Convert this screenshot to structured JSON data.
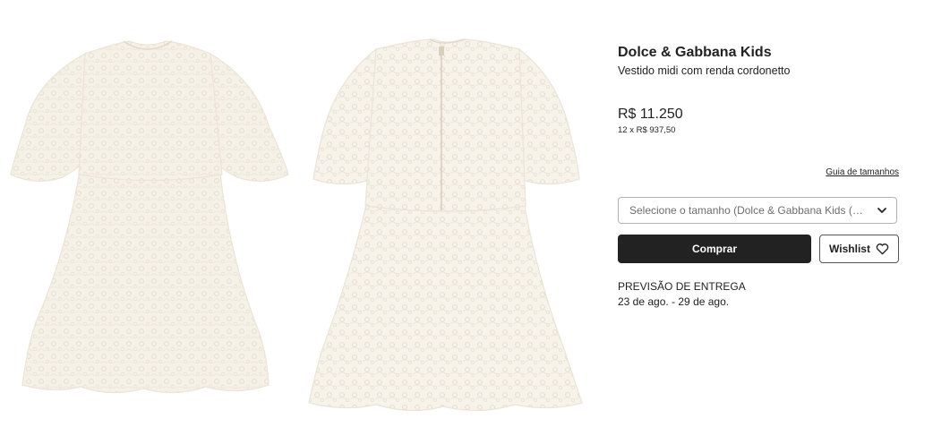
{
  "product": {
    "brand": "Dolce & Gabbana Kids",
    "name": "Vestido midi com renda cordonetto",
    "price": "R$ 11.250",
    "installments": "12 x R$ 937,50"
  },
  "size": {
    "guide_link": "Guia de tamanhos",
    "placeholder": "Selecione o tamanho (Dolce & Gabbana Kids (an..."
  },
  "actions": {
    "buy_label": "Comprar",
    "wishlist_label": "Wishlist",
    "wishlist_icon": "heart-icon"
  },
  "delivery": {
    "title": "PREVISÃO DE ENTREGA",
    "dates": "23 de ago. - 29 de ago."
  },
  "gallery": {
    "images": [
      "dress-front",
      "dress-back"
    ],
    "dress_color": "#f6f1e7"
  },
  "colors": {
    "primary_button": "#222222",
    "text": "#222222",
    "muted_text": "#6e6e6e",
    "border": "#b3b3b3"
  }
}
